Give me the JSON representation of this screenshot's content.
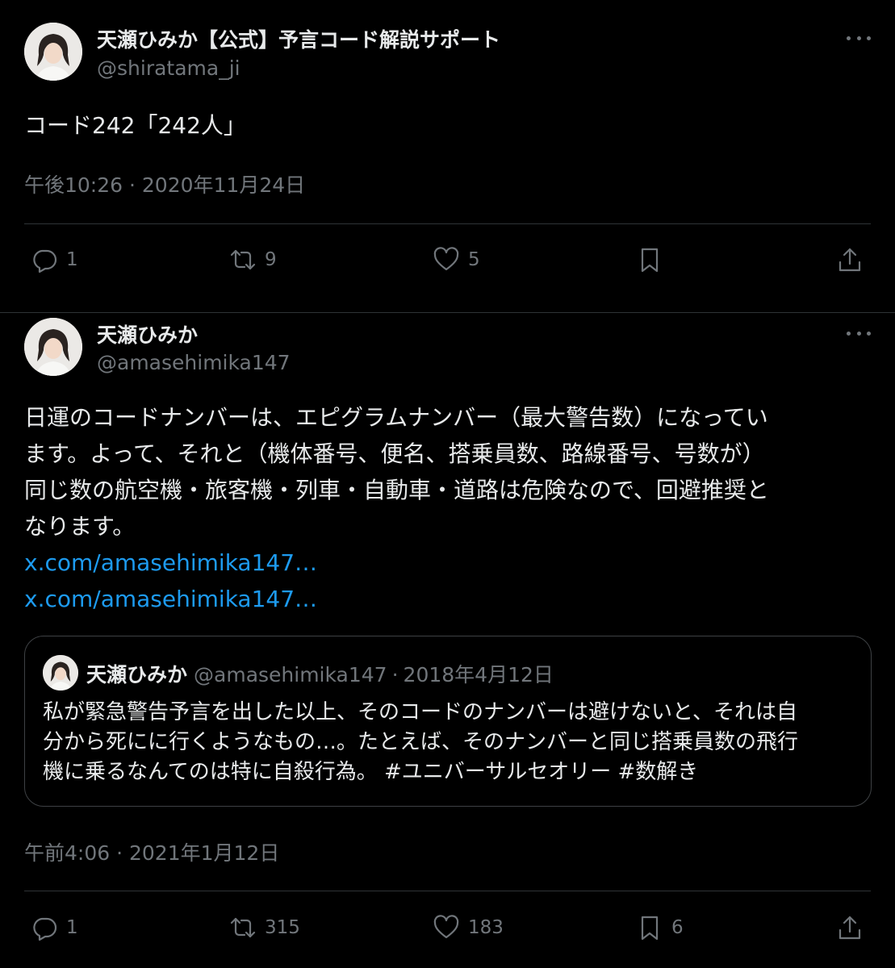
{
  "tweets": [
    {
      "display_name": "天瀬ひみか【公式】予言コード解説サポート",
      "handle": "@shiratama_ji",
      "text": "コード242「242人」",
      "timestamp": "午後10:26 · 2020年11月24日",
      "stats": {
        "replies": "1",
        "retweets": "9",
        "likes": "5"
      }
    },
    {
      "display_name": "天瀬ひみか",
      "handle": "@amasehimika147",
      "text_lines": [
        "日運のコードナンバーは、エピグラムナンバー（最大警告数）になってい",
        "ます。よって、それと（機体番号、便名、搭乗員数、路線番号、号数が）",
        "同じ数の航空機・旅客機・列車・自動車・道路は危険なので、回避推奨と",
        "なります。"
      ],
      "links": [
        "x.com/amasehimika147…",
        "x.com/amasehimika147…"
      ],
      "quote": {
        "display_name": "天瀬ひみか",
        "handle": "@amasehimika147",
        "date": "2018年4月12日",
        "text_lines": [
          "私が緊急警告予言を出した以上、そのコードのナンバーは避けないと、それは自",
          "分から死にに行くようなもの…。たとえば、そのナンバーと同じ搭乗員数の飛行",
          "機に乗るなんてのは特に自殺行為。 #ユニバーサルセオリー #数解き"
        ]
      },
      "timestamp": "午前4:06 · 2021年1月12日",
      "stats": {
        "replies": "1",
        "retweets": "315",
        "likes": "183",
        "bookmarks": "6"
      }
    }
  ],
  "icons": [
    "reply-icon",
    "retweet-icon",
    "like-icon",
    "bookmark-icon",
    "share-icon",
    "more-icon"
  ],
  "colors": {
    "background": "#000000",
    "text": "#e7e9ea",
    "muted": "#71767b",
    "link": "#1d9bf0",
    "divider": "#2f3336"
  }
}
